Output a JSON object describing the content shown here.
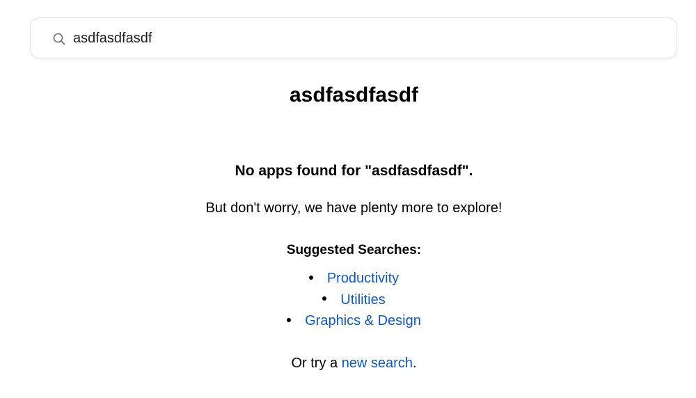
{
  "search": {
    "value": "asdfasdfasdf",
    "icon": "search-icon"
  },
  "page_title": "asdfasdfasdf",
  "no_results_message": "No apps found for \"asdfasdfasdf\".",
  "subtext": "But don't worry, we have plenty more to explore!",
  "suggested": {
    "heading": "Suggested Searches:",
    "items": [
      {
        "label": "Productivity"
      },
      {
        "label": "Utilities"
      },
      {
        "label": "Graphics & Design"
      }
    ]
  },
  "try_again": {
    "prefix": "Or try a ",
    "link_label": "new search",
    "suffix": "."
  },
  "colors": {
    "link": "#0b57d0",
    "text": "#000000",
    "border": "#e3e3e6"
  }
}
